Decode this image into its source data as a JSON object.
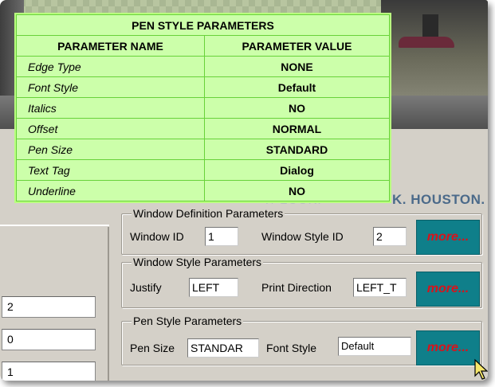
{
  "video_overlay": {
    "houston_text": "K. HOUSTON.",
    "faded_text": "T/ 2UUK."
  },
  "pen_style_table": {
    "title": "PEN STYLE PARAMETERS",
    "headers": [
      "PARAMETER NAME",
      "PARAMETER VALUE"
    ],
    "rows": [
      {
        "name": "Edge Type",
        "value": "NONE"
      },
      {
        "name": "Font Style",
        "value": "Default"
      },
      {
        "name": "Italics",
        "value": "NO"
      },
      {
        "name": "Offset",
        "value": "NORMAL"
      },
      {
        "name": "Pen Size",
        "value": "STANDARD"
      },
      {
        "name": "Text Tag",
        "value": "Dialog"
      },
      {
        "name": "Underline",
        "value": "NO"
      }
    ],
    "colors": {
      "background": "#ccffaa",
      "border": "#68d23a"
    }
  },
  "left_inputs": [
    "2",
    "0",
    "1"
  ],
  "window_definition": {
    "legend": "Window Definition Parameters",
    "window_id_label": "Window ID",
    "window_id_value": "1",
    "window_style_id_label": "Window Style ID",
    "window_style_id_value": "2",
    "more_label": "more..."
  },
  "window_style": {
    "legend": "Window Style Parameters",
    "justify_label": "Justify",
    "justify_value": "LEFT",
    "print_direction_label": "Print Direction",
    "print_direction_value": "LEFT_T",
    "more_label": "more..."
  },
  "pen_style": {
    "legend": "Pen Style Parameters",
    "pen_size_label": "Pen Size",
    "pen_size_value": "STANDAR",
    "font_style_label": "Font Style",
    "font_style_value": "Default",
    "more_label": "more..."
  },
  "colors": {
    "more_button_bg": "#0f7f8a",
    "more_button_text": "#d8131b",
    "window_bg": "#d4d0c8"
  },
  "icons": {
    "cursor": "mouse-pointer-icon"
  }
}
